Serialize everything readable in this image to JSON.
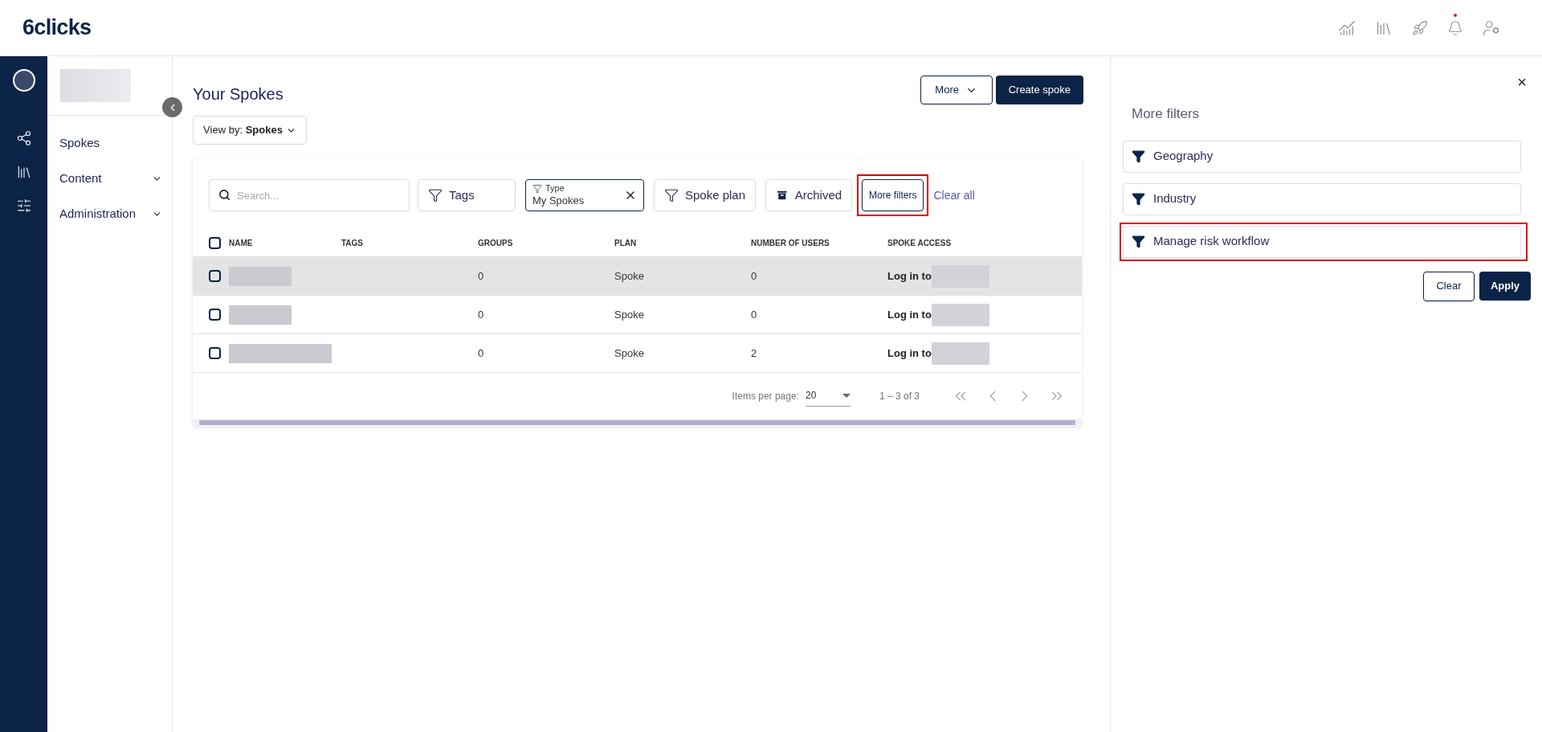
{
  "header": {
    "logo": "6clicks",
    "notification_dot": true
  },
  "sidebar": {
    "items": [
      {
        "label": "Spokes",
        "expandable": false
      },
      {
        "label": "Content",
        "expandable": true
      },
      {
        "label": "Administration",
        "expandable": true
      }
    ]
  },
  "main": {
    "title": "Your Spokes",
    "view_by": {
      "label": "View by:",
      "value": "Spokes"
    },
    "actions": [
      {
        "label": "More",
        "kind": "dropdown"
      },
      {
        "label": "Create spoke",
        "kind": "primary"
      }
    ],
    "search": {
      "placeholder": "Search..."
    },
    "filters": [
      {
        "kind": "filter",
        "label": "Tags",
        "highlighted": false
      },
      {
        "kind": "active",
        "label": "Type",
        "value": "My Spokes",
        "highlighted": false
      },
      {
        "kind": "filter",
        "label": "Spoke plan",
        "highlighted": false
      },
      {
        "kind": "archive",
        "label": "Archived",
        "highlighted": false
      },
      {
        "kind": "more",
        "label": "More filters",
        "highlighted": true
      },
      {
        "kind": "link",
        "label": "Clear all",
        "highlighted": false
      }
    ],
    "table": {
      "select_all_checked": false,
      "columns": [
        "NAME",
        "TAGS",
        "GROUPS",
        "PLAN",
        "NUMBER OF USERS",
        "SPOKE ACCESS"
      ],
      "rows": [
        {
          "checked": false,
          "hovered": true,
          "groups": "0",
          "plan": "Spoke",
          "users": "0",
          "access": "Log in to"
        },
        {
          "checked": false,
          "hovered": false,
          "groups": "0",
          "plan": "Spoke",
          "users": "0",
          "access": "Log in to"
        },
        {
          "checked": false,
          "hovered": false,
          "groups": "0",
          "plan": "Spoke",
          "users": "2",
          "access": "Log in to"
        }
      ]
    },
    "pagination": {
      "items_label": "Items per page:",
      "page_size": "20",
      "range": "1 – 3 of 3"
    }
  },
  "panel": {
    "title": "More filters",
    "close": "×",
    "filters": [
      {
        "label": "Geography",
        "highlighted": false
      },
      {
        "label": "Industry",
        "highlighted": false
      },
      {
        "label": "Manage risk workflow",
        "highlighted": true
      }
    ],
    "buttons": [
      {
        "label": "Clear",
        "kind": "secondary"
      },
      {
        "label": "Apply",
        "kind": "primary"
      }
    ]
  }
}
